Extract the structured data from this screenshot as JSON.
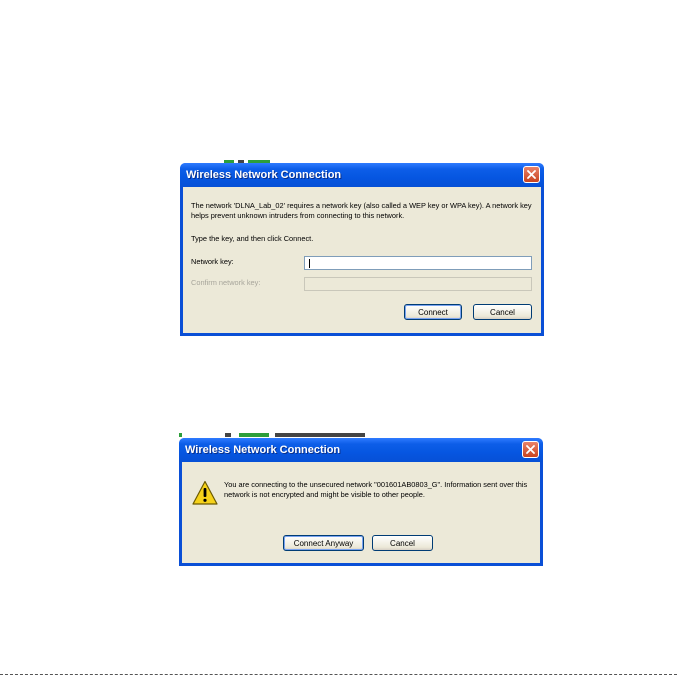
{
  "dialog_key": {
    "title": "Wireless Network Connection",
    "message": "The network 'DLNA_Lab_02' requires a network key (also called a WEP key or WPA key). A network key helps prevent unknown intruders from connecting to this network.",
    "instruction": "Type the key, and then click Connect.",
    "network_key_label": "Network key:",
    "network_key_value": "",
    "confirm_key_label": "Confirm network key:",
    "confirm_key_value": "",
    "connect_label": "Connect",
    "cancel_label": "Cancel"
  },
  "dialog_unsecured": {
    "title": "Wireless Network Connection",
    "message": "You are connecting to the unsecured network \"001601AB0803_G\". Information sent over this network is not encrypted and might be visible to other people.",
    "connect_anyway_label": "Connect Anyway",
    "cancel_label": "Cancel",
    "icon": "warning-icon"
  },
  "colors": {
    "titlebar": "#0656e1",
    "dialog_body": "#ece9d8",
    "close_button": "#c9431f",
    "warning_yellow": "#f6d21a"
  }
}
